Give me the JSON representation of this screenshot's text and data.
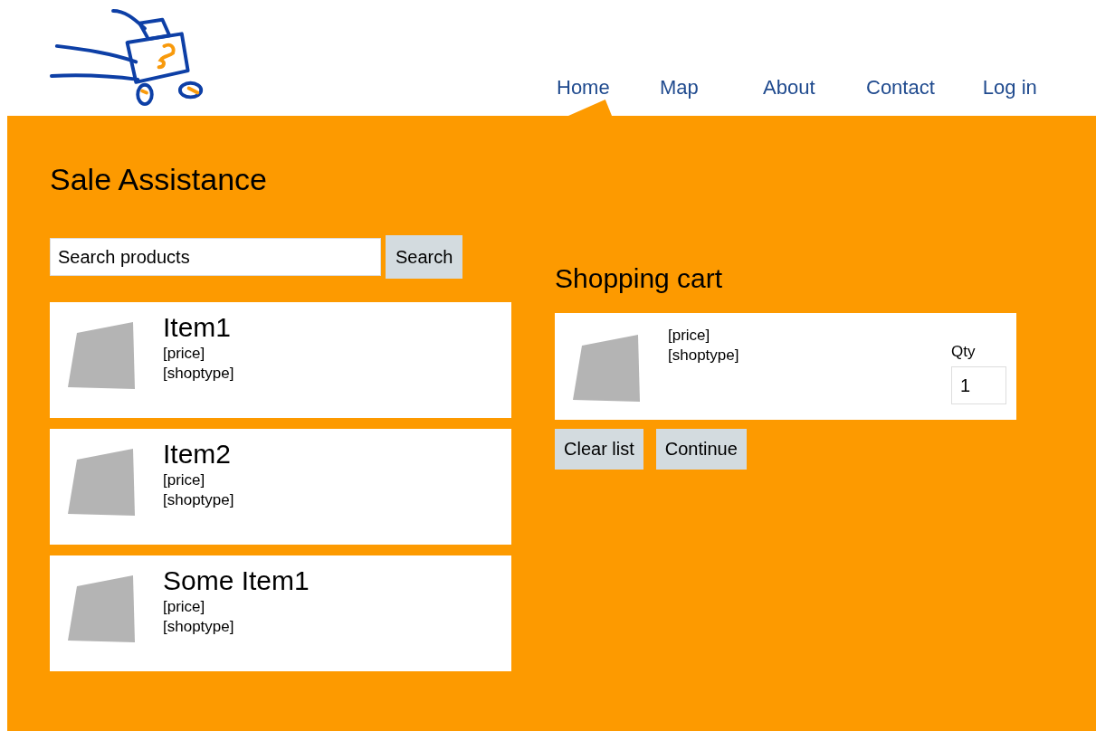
{
  "nav": [
    {
      "label": "Home",
      "selected": true
    },
    {
      "label": "Map",
      "selected": false
    },
    {
      "label": "About",
      "selected": false
    },
    {
      "label": "Contact",
      "selected": false
    },
    {
      "label": "Log in",
      "selected": false
    }
  ],
  "title": "Sale Assistance",
  "search": {
    "value": "Search products",
    "button": "Search"
  },
  "products": [
    {
      "name": "Item1",
      "price": "[price]",
      "shoptype": "[shoptype]"
    },
    {
      "name": "Item2",
      "price": "[price]",
      "shoptype": "[shoptype]"
    },
    {
      "name": "Some Item1",
      "price": "[price]",
      "shoptype": "[shoptype]"
    }
  ],
  "cart": {
    "title": "Shopping cart",
    "items": [
      {
        "price": "[price]",
        "shoptype": "[shoptype]",
        "qty_label": "Qty",
        "qty": "1"
      }
    ],
    "buttons": [
      "Clear list",
      "Continue"
    ]
  }
}
